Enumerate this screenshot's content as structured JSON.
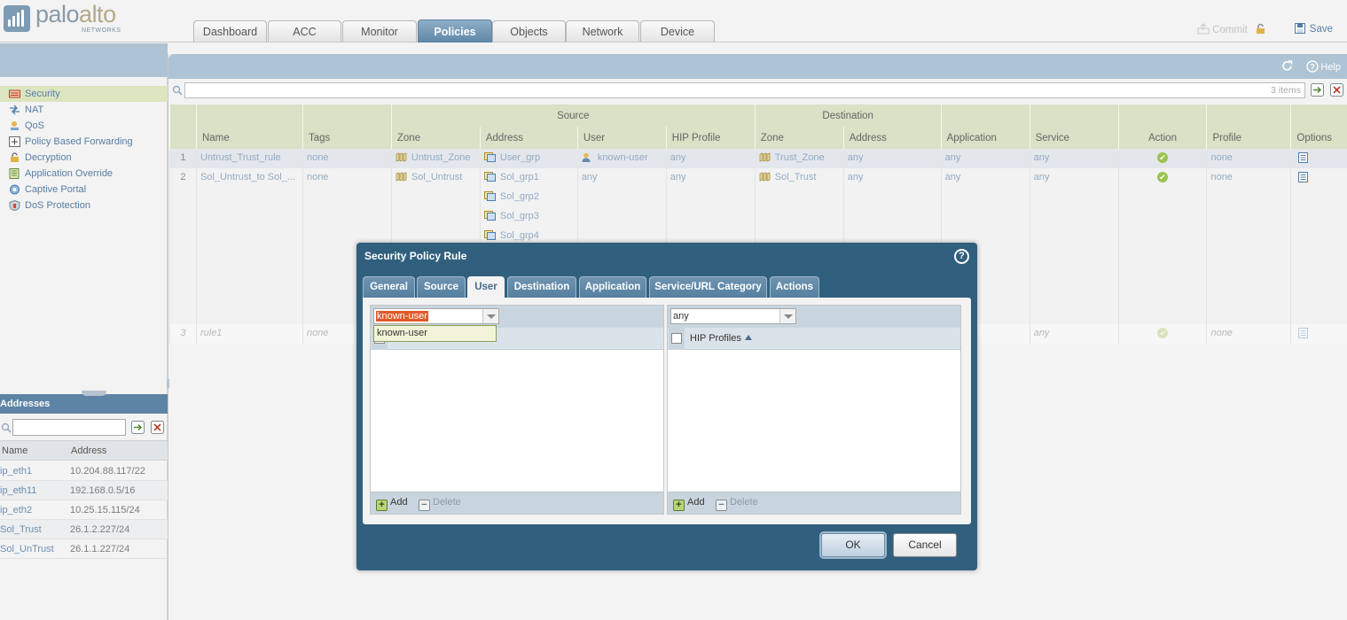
{
  "brand": {
    "logo_main_a": "palo",
    "logo_main_b": "alto",
    "logo_sub": "NETWORKS"
  },
  "nav_tabs": [
    {
      "label": "Dashboard"
    },
    {
      "label": "ACC"
    },
    {
      "label": "Monitor"
    },
    {
      "label": "Policies"
    },
    {
      "label": "Objects"
    },
    {
      "label": "Network"
    },
    {
      "label": "Device"
    }
  ],
  "active_tab": "Policies",
  "header_actions": {
    "commit": "Commit",
    "save": "Save"
  },
  "sidebar": {
    "items": [
      {
        "label": "Security",
        "icon": "security-rules-icon"
      },
      {
        "label": "NAT",
        "icon": "nat-icon"
      },
      {
        "label": "QoS",
        "icon": "qos-icon"
      },
      {
        "label": "Policy Based Forwarding",
        "icon": "pbf-icon"
      },
      {
        "label": "Decryption",
        "icon": "lock-icon"
      },
      {
        "label": "Application Override",
        "icon": "app-override-icon"
      },
      {
        "label": "Captive Portal",
        "icon": "captive-portal-icon"
      },
      {
        "label": "DoS Protection",
        "icon": "dos-icon"
      }
    ],
    "selected": "Security"
  },
  "addresses": {
    "title": "Addresses",
    "columns": [
      "Name",
      "Address"
    ],
    "rows": [
      {
        "name": "ip_eth1",
        "address": "10.204.88.117/22"
      },
      {
        "name": "ip_eth11",
        "address": "192.168.0.5/16"
      },
      {
        "name": "ip_eth2",
        "address": "10.25.15.115/24"
      },
      {
        "name": "Sol_Trust",
        "address": "26.1.2.227/24"
      },
      {
        "name": "Sol_UnTrust",
        "address": "26.1.1.227/24"
      }
    ]
  },
  "toolbar": {
    "help": "Help",
    "items_count": "3 items"
  },
  "rules_table": {
    "group_headers": {
      "source": "Source",
      "destination": "Destination"
    },
    "columns": [
      "Name",
      "Tags",
      "Zone",
      "Address",
      "User",
      "HIP Profile",
      "Zone",
      "Address",
      "Application",
      "Service",
      "Action",
      "Profile",
      "Options"
    ],
    "rows": [
      {
        "num": "1",
        "name": "Untrust_Trust_rule",
        "tags": "none",
        "src_zone": "Untrust_Zone",
        "src_addr": [
          "User_grp"
        ],
        "user": "known-user",
        "hip": "any",
        "dst_zone": "Trust_Zone",
        "dst_addr": "any",
        "app": "any",
        "service": "any",
        "profile": "none"
      },
      {
        "num": "2",
        "name": "Sol_Untrust_to Sol_...",
        "tags": "none",
        "src_zone": "Sol_Untrust",
        "src_addr": [
          "Sol_grp1",
          "Sol_grp2",
          "Sol_grp3",
          "Sol_grp4"
        ],
        "user": "any",
        "hip": "any",
        "dst_zone": "Sol_Trust",
        "dst_addr": "any",
        "app": "any",
        "service": "any",
        "profile": "none"
      },
      {
        "num": "3",
        "name": "rule1",
        "tags": "none",
        "service": "any",
        "profile": "none"
      }
    ]
  },
  "modal": {
    "title": "Security Policy Rule",
    "tabs": [
      "General",
      "Source",
      "User",
      "Destination",
      "Application",
      "Service/URL Category",
      "Actions"
    ],
    "active_tab": "User",
    "user_combo": {
      "value": "known-user",
      "dropdown_option": "known-user"
    },
    "hip_combo": {
      "value": "any"
    },
    "hip_column": "HIP Profiles",
    "add_label": "Add",
    "delete_label": "Delete",
    "ok": "OK",
    "cancel": "Cancel"
  },
  "colors": {
    "accent": "#5f87a8",
    "modal_bg": "#30607e",
    "selected_nav": "#dde5bf",
    "header_green": "#d9e1c6",
    "highlight": "#e05a2b"
  }
}
